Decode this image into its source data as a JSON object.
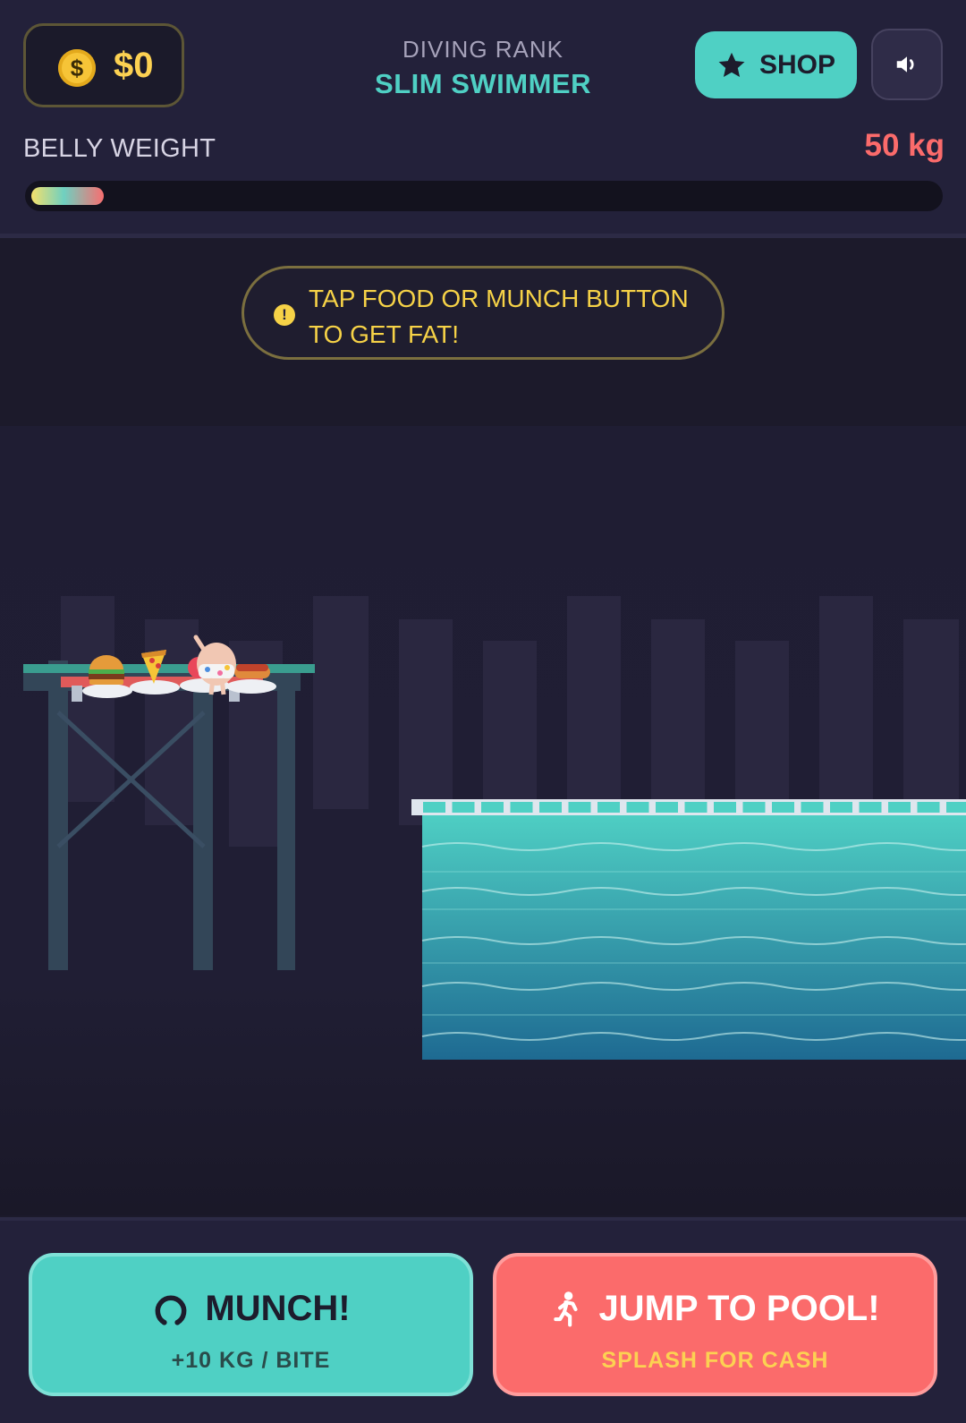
{
  "hud": {
    "coins": "$0",
    "coin_symbol": "$",
    "rank_label": "DIVING RANK",
    "rank_value": "SLIM SWIMMER",
    "shop_label": "SHOP",
    "weight_label": "BELLY WEIGHT",
    "weight_value": "50 kg",
    "weight_fill_fraction": 0.08
  },
  "tip": {
    "icon": "!",
    "text": "TAP FOOD OR MUNCH BUTTON TO GET FAT!"
  },
  "controls": {
    "munch_title": "MUNCH!",
    "munch_sub": "+10 KG / BITE",
    "jump_title": "JUMP TO POOL!",
    "jump_sub": "SPLASH FOR CASH"
  },
  "icons": {
    "coin": "coin-icon",
    "shop": "star-icon",
    "sound": "speaker-icon",
    "tip": "exclamation-icon",
    "munch": "mouth-icon",
    "jump": "running-person-icon"
  },
  "colors": {
    "accent_teal": "#4fd0c4",
    "accent_red": "#fb6b6b",
    "accent_gold": "#fcd152",
    "background": "#23213a"
  }
}
